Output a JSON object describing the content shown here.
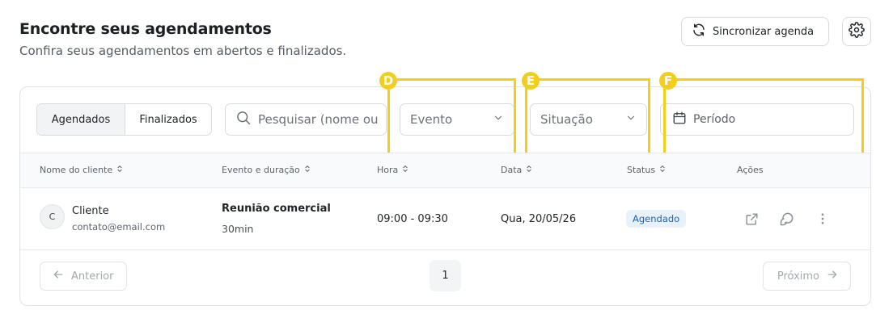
{
  "header": {
    "title": "Encontre seus agendamentos",
    "subtitle": "Confira seus agendamentos em abertos e finalizados.",
    "sync_label": "Sincronizar agenda"
  },
  "filters": {
    "tabs": [
      {
        "label": "Agendados",
        "active": true
      },
      {
        "label": "Finalizados",
        "active": false
      }
    ],
    "search_placeholder": "Pesquisar (nome ou",
    "evento_label": "Evento",
    "situacao_label": "Situação",
    "periodo_label": "Período"
  },
  "markers": [
    "D",
    "E",
    "F"
  ],
  "marker_color": "#f1cf1c",
  "table": {
    "columns": [
      "Nome do cliente",
      "Evento e duração",
      "Hora",
      "Data",
      "Status",
      "Ações"
    ],
    "rows": [
      {
        "avatar_initial": "C",
        "client_name": "Cliente",
        "client_email": "contato@email.com",
        "event_name": "Reunião comercial",
        "event_duration": "30min",
        "time": "09:00 - 09:30",
        "date": "Qua, 20/05/26",
        "status": "Agendado",
        "actions": [
          "external-link-icon",
          "chat-icon",
          "more-vertical-icon"
        ]
      }
    ]
  },
  "pagination": {
    "prev_label": "Anterior",
    "current_page": "1",
    "next_label": "Próximo"
  },
  "colors": {
    "status_bg": "#e9f2fb",
    "status_text": "#1c64b5"
  }
}
